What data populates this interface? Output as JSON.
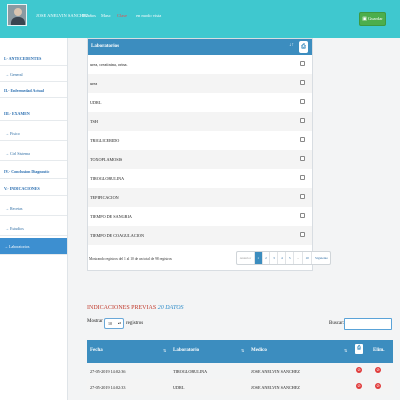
{
  "topbar": {
    "patient_name": "JOSE ANELVIN SANCHEZ",
    "age": "58 años",
    "sex": "Masc",
    "plan": "Clase",
    "mode": "en modo vista",
    "save_label": "Guardar"
  },
  "sidebar": {
    "items": [
      {
        "label": "I.- ANTECEDENTES",
        "kind": "head"
      },
      {
        "label": "→ General",
        "kind": "sub"
      },
      {
        "label": "II.- Enfermedad Actual",
        "kind": "head"
      },
      {
        "label": "III.- EXAMEN",
        "kind": "head"
      },
      {
        "label": "→ Fisico",
        "kind": "sub"
      },
      {
        "label": "→ Ctrl Sistema",
        "kind": "sub"
      },
      {
        "label": "IV.- Conclusion Diagnostic",
        "kind": "head"
      },
      {
        "label": "V.- INDICACIONES",
        "kind": "head"
      },
      {
        "label": "→ Recetas",
        "kind": "sub"
      },
      {
        "label": "→ Estudios",
        "kind": "sub"
      },
      {
        "label": "→ Laboratorios",
        "kind": "active"
      }
    ]
  },
  "lab_panel": {
    "header": "Laboratorios",
    "rows": [
      "urea, creatinina, orina.",
      "urea",
      "UDRL",
      "TSH",
      "TRIGLICERIDO",
      "TOXOPLAMOSIS",
      "TIROGLOBULINA",
      "TEPIFICACION",
      "TIEMPO DE SANGRIA",
      "TIEMPO DE COAGULACION"
    ],
    "info": "Mostrando registros del 1 al 10 de un total de 98 registros",
    "pager": [
      "Anterior",
      "1",
      "2",
      "3",
      "4",
      "5",
      "...",
      "10",
      "Siguiente"
    ],
    "current_page": "1"
  },
  "previous": {
    "title_a": "INDICACIONES",
    "title_b": "PREVIAS",
    "title_c": "20 DATOS",
    "show_label": "Mostrar",
    "show_value": "10",
    "registros_label": "registros",
    "search_label": "Buscar:",
    "search_value": "",
    "columns": [
      "Fecha",
      "Laboratorio",
      "Medico",
      "Elim."
    ],
    "rows": [
      {
        "fecha": "27-05-2019 14:02:36",
        "lab": "TIROGLOBULINA",
        "medico": "JOSE ANELVIN SANCHEZ"
      },
      {
        "fecha": "27-05-2019 14:02:33",
        "lab": "UDRL",
        "medico": "JOSE ANELVIN SANCHEZ"
      }
    ]
  },
  "colors": {
    "topbar": "#3fc8cf",
    "header_blue": "#3c8dbf",
    "active_sidebar": "#3d8fd0",
    "save_green": "#4cae4c",
    "delete_red": "#e03b3b"
  },
  "icons": {
    "save": "save-icon",
    "print": "print-icon",
    "sort": "sort-icon",
    "delete": "delete-icon"
  }
}
